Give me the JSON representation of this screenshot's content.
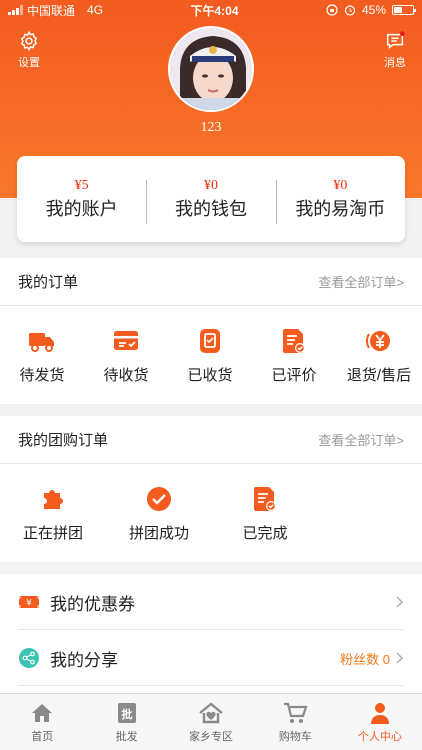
{
  "status_bar": {
    "carrier": "中国联通",
    "network": "4G",
    "time": "下午4:04",
    "battery": "45%"
  },
  "header": {
    "settings_label": "设置",
    "messages_label": "消息",
    "username": "123"
  },
  "wallet": [
    {
      "value": "¥5",
      "label": "我的账户"
    },
    {
      "value": "¥0",
      "label": "我的钱包"
    },
    {
      "value": "¥0",
      "label": "我的易淘币"
    }
  ],
  "orders": {
    "title": "我的订单",
    "more": "查看全部订单>",
    "items": [
      {
        "label": "待发货",
        "icon": "truck-icon"
      },
      {
        "label": "待收货",
        "icon": "card-icon"
      },
      {
        "label": "已收货",
        "icon": "package-icon"
      },
      {
        "label": "已评价",
        "icon": "review-icon"
      },
      {
        "label": "退货/售后",
        "icon": "refund-icon"
      }
    ]
  },
  "group_orders": {
    "title": "我的团购订单",
    "more": "查看全部订单>",
    "items": [
      {
        "label": "正在拼团",
        "icon": "puzzle-icon"
      },
      {
        "label": "拼团成功",
        "icon": "check-circle-icon"
      },
      {
        "label": "已完成",
        "icon": "complete-doc-icon"
      }
    ]
  },
  "menu": {
    "coupons": {
      "label": "我的优惠券"
    },
    "share": {
      "label": "我的分享",
      "extra": "粉丝数 0"
    }
  },
  "tabbar": [
    {
      "label": "首页",
      "icon": "home-icon"
    },
    {
      "label": "批发",
      "icon": "wholesale-icon"
    },
    {
      "label": "家乡专区",
      "icon": "hometown-icon"
    },
    {
      "label": "购物车",
      "icon": "cart-icon"
    },
    {
      "label": "个人中心",
      "icon": "person-icon",
      "active": true
    }
  ],
  "colors": {
    "accent": "#f35b1f",
    "price": "#e8330f",
    "fans": "#f07a1a",
    "share_icon": "#3cc2b0"
  }
}
